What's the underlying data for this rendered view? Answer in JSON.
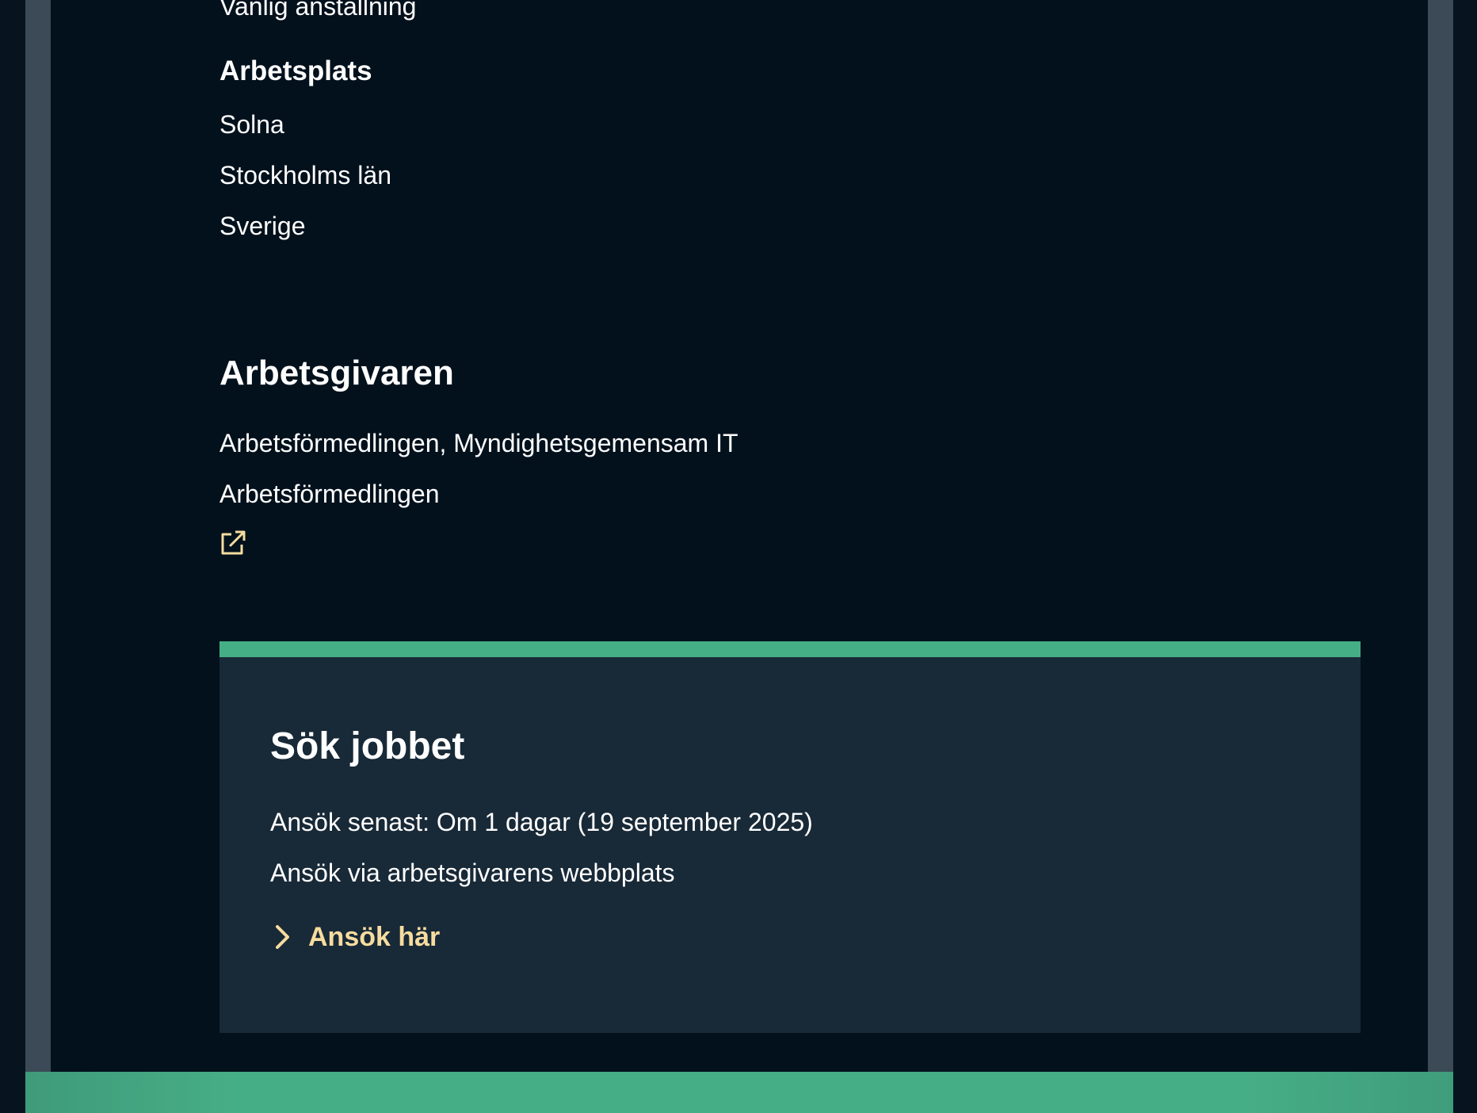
{
  "employment": {
    "type_value": "Vanlig anställning"
  },
  "workplace": {
    "heading": "Arbetsplats",
    "city": "Solna",
    "county": "Stockholms län",
    "country": "Sverige"
  },
  "employer": {
    "heading": "Arbetsgivaren",
    "department": "Arbetsförmedlingen, Myndighetsgemensam IT",
    "name": "Arbetsförmedlingen",
    "link_icon": "external-link-icon"
  },
  "apply": {
    "heading": "Sök jobbet",
    "deadline": "Ansök senast: Om 1 dagar (19 september 2025)",
    "method": "Ansök via arbetsgivarens webbplats",
    "link_label": "Ansök här",
    "link_icon": "chevron-right-icon"
  },
  "colors": {
    "accent_green": "#46ae86",
    "link_yellow": "#f6dc9f",
    "card_background": "#182937",
    "page_background": "#03111c"
  }
}
